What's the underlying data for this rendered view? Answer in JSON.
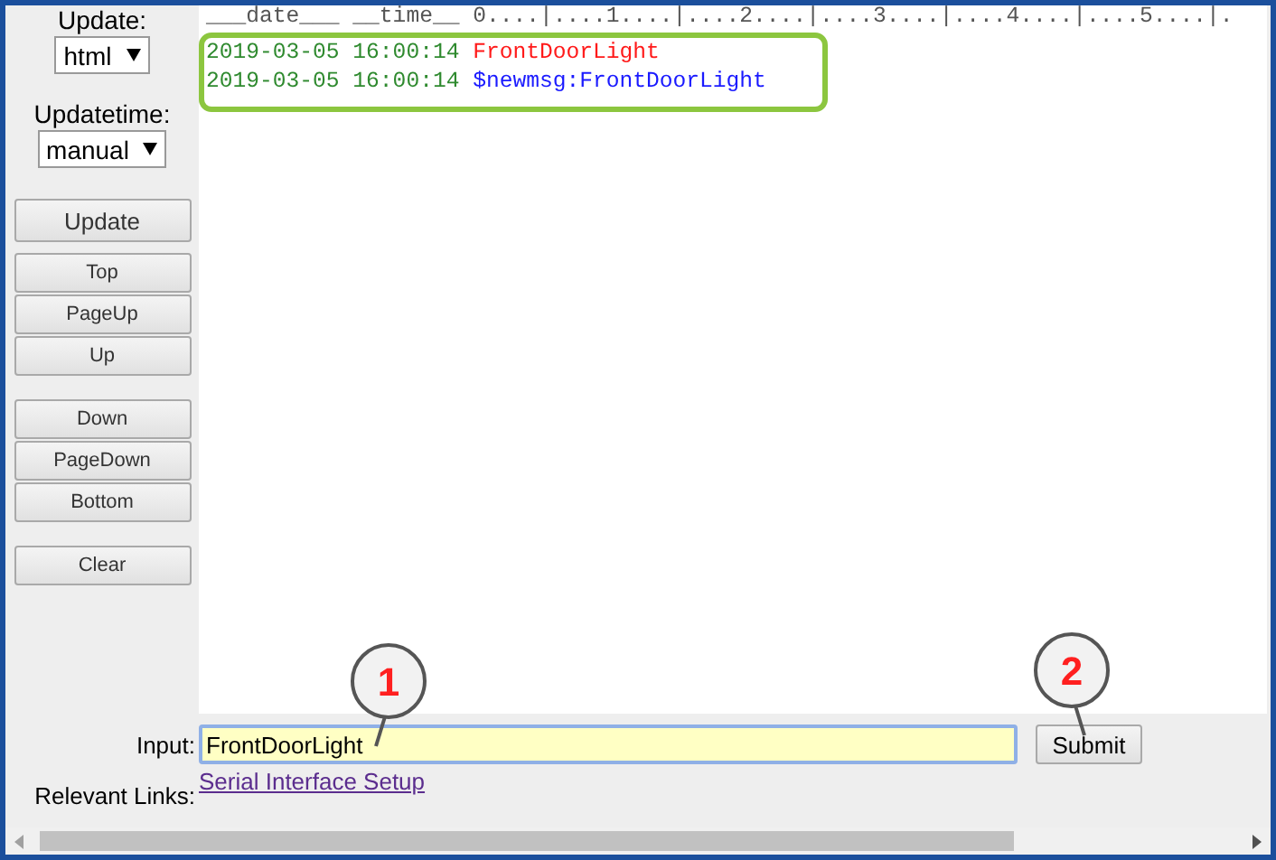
{
  "sidebar": {
    "update_label": "Update:",
    "update_select": "html",
    "updatetime_label": "Updatetime:",
    "updatetime_select": "manual",
    "update_button": "Update",
    "button_groups": [
      [
        "Top",
        "PageUp",
        "Up"
      ],
      [
        "Down",
        "PageDown",
        "Bottom"
      ],
      [
        "Clear"
      ]
    ]
  },
  "log": {
    "header": "___date___ __time__ 0....|....1....|....2....|....3....|....4....|....5....|.",
    "lines": [
      {
        "date": "2019-03-05",
        "time": "16:00:14",
        "message": "FrontDoorLight",
        "kind": "received"
      },
      {
        "date": "2019-03-05",
        "time": "16:00:14",
        "message": "$newmsg:FrontDoorLight",
        "kind": "sent"
      }
    ]
  },
  "input": {
    "label": "Input:",
    "value": "FrontDoorLight"
  },
  "submit_button": "Submit",
  "links": {
    "label": "Relevant Links:",
    "items": [
      "Serial Interface Setup"
    ]
  },
  "callouts": [
    "1",
    "2"
  ]
}
